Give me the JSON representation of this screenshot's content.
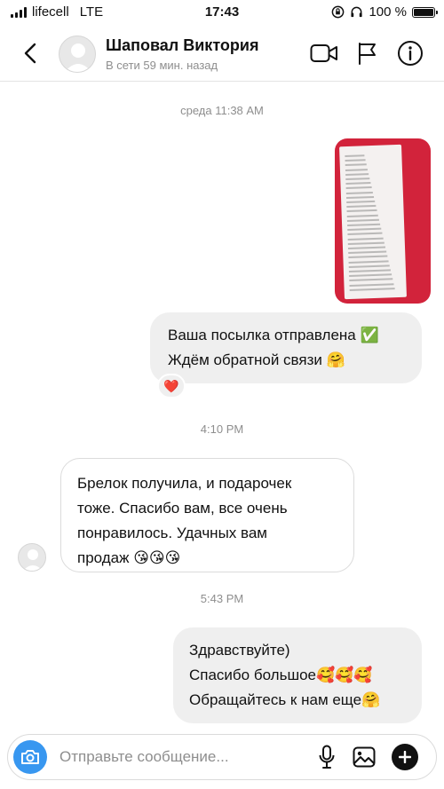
{
  "status_bar": {
    "carrier": "lifecell",
    "network": "LTE",
    "time": "17:43",
    "battery": "100 %",
    "battery_level": 1.0
  },
  "header": {
    "contact_name": "Шаповал Виктория",
    "contact_status": "В сети 59 мин. назад",
    "icons": [
      "back-icon",
      "video-call-icon",
      "flag-icon",
      "info-icon"
    ]
  },
  "chat": {
    "timestamps": [
      "среда 11:38 AM",
      "4:10 PM",
      "5:43 PM"
    ],
    "messages": [
      {
        "direction": "out",
        "type": "photo",
        "description_icon": "photo-receipt"
      },
      {
        "direction": "out",
        "type": "text",
        "lines": [
          "Ваша посылка отправлена ✅",
          "Ждём обратной связи 🤗"
        ],
        "reaction": "❤️"
      },
      {
        "direction": "in",
        "type": "text",
        "lines": [
          "Брелок получила,  и подарочек",
          "тоже.  Спасибо вам,  все очень",
          "понравилось.  Удачных вам",
          "продаж 😘😘😘"
        ]
      },
      {
        "direction": "out",
        "type": "text",
        "lines": [
          "Здравствуйте)",
          "Спасибо большое🥰🥰🥰",
          "Обращайтесь к нам еще🤗"
        ]
      }
    ]
  },
  "composer": {
    "placeholder": "Отправьте сообщение...",
    "icons": [
      "camera-icon",
      "microphone-icon",
      "gallery-icon",
      "add-icon"
    ]
  },
  "colors": {
    "accent": "#3897f0",
    "outgoing_bubble": "#efefef",
    "muted_text": "#8e8e8e"
  }
}
